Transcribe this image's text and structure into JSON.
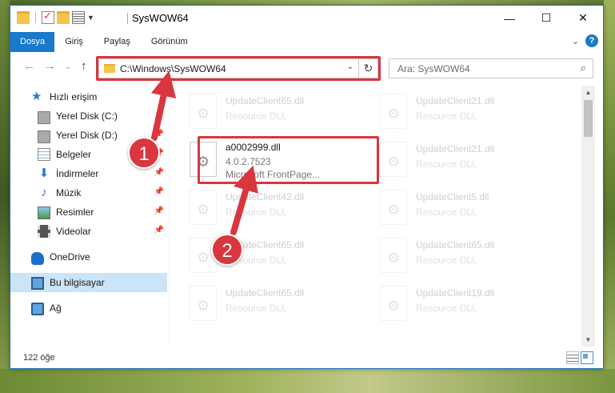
{
  "window": {
    "title": "SysWOW64",
    "controls": {
      "minimize": "—",
      "maximize": "☐",
      "close": "✕"
    }
  },
  "ribbon": {
    "tabs": [
      {
        "label": "Dosya",
        "active": true
      },
      {
        "label": "Giriş"
      },
      {
        "label": "Paylaş"
      },
      {
        "label": "Görünüm"
      }
    ],
    "help": "?",
    "expand": "⌄"
  },
  "nav": {
    "back": "←",
    "forward": "→",
    "recent": "⌄",
    "up": "↑"
  },
  "address": {
    "path": "C:\\Windows\\SysWOW64",
    "dropdown": "⌄",
    "refresh": "↻"
  },
  "search": {
    "placeholder": "Ara: SysWOW64",
    "icon": "⌕"
  },
  "sidebar": {
    "items": [
      {
        "label": "Hızlı erişim",
        "icon": "star-icon"
      },
      {
        "label": "Yerel Disk (C:)",
        "icon": "disk-icon",
        "pinned": true
      },
      {
        "label": "Yerel Disk (D:)",
        "icon": "disk-icon",
        "pinned": true
      },
      {
        "label": "Belgeler",
        "icon": "documents-icon",
        "pinned": true
      },
      {
        "label": "İndirmeler",
        "icon": "download-icon",
        "pinned": true
      },
      {
        "label": "Müzik",
        "icon": "music-icon",
        "pinned": true
      },
      {
        "label": "Resimler",
        "icon": "pictures-icon",
        "pinned": true
      },
      {
        "label": "Videolar",
        "icon": "videos-icon",
        "pinned": true
      },
      {
        "label": "OneDrive",
        "icon": "onedrive-icon"
      },
      {
        "label": "Bu bilgisayar",
        "icon": "this-pc-icon",
        "selected": true
      },
      {
        "label": "Ağ",
        "icon": "network-icon"
      }
    ],
    "pin_glyph": "📌"
  },
  "files": {
    "highlighted": {
      "name": "a0002999.dll",
      "version": "4.0.2.7523",
      "description": "Microsoft FrontPage..."
    },
    "left": [
      {
        "name": "UpdateClient65.dll",
        "desc": "Resource DLL"
      },
      {
        "name": "UpdateClient42.dll",
        "desc": "Resource DLL"
      },
      {
        "name": "UpdateClient65.dll",
        "desc": "Resource DLL"
      },
      {
        "name": "UpdateClient65.dll",
        "desc": "Resource DLL"
      }
    ],
    "right": [
      {
        "name": "UpdateClient21.dll",
        "desc": "Resource DLL"
      },
      {
        "name": "UpdateClient21.dll",
        "desc": "Resource DLL"
      },
      {
        "name": "UpdateClient5.dll",
        "desc": "Resource DLL"
      },
      {
        "name": "UpdateClient65.dll",
        "desc": "Resource DLL"
      },
      {
        "name": "UpdateClient19.dll",
        "desc": "Resource DLL"
      }
    ]
  },
  "status": {
    "item_count": "122 öğe"
  },
  "callouts": {
    "step1": "1",
    "step2": "2",
    "color": "#d9363e"
  }
}
